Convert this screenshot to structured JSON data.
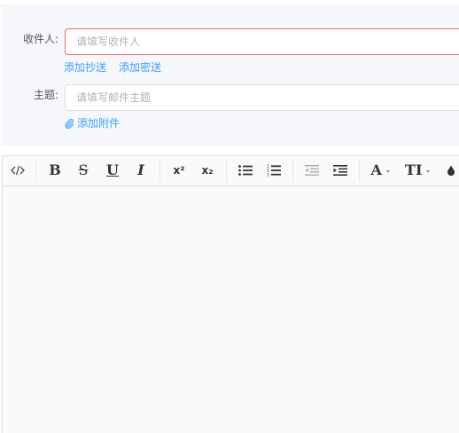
{
  "form": {
    "recipient_label": "收件人:",
    "recipient_placeholder": "请填写收件人",
    "add_cc": "添加抄送",
    "add_bcc": "添加密送",
    "subject_label": "主题:",
    "subject_placeholder": "请填写邮件主题",
    "add_attachment": "添加附件"
  },
  "toolbar": {
    "bold": "B",
    "strikethrough": "S",
    "underline": "U",
    "italic": "I",
    "superscript": "x²",
    "subscript": "x₂",
    "font": "A",
    "font_size": "TI"
  },
  "icons": {
    "code": "code-icon",
    "bullet_list": "bullet-list-icon",
    "numbered_list": "numbered-list-icon",
    "outdent": "outdent-icon",
    "indent": "indent-icon",
    "color": "color-drop-icon",
    "attachment": "paperclip-icon"
  },
  "colors": {
    "accent": "#409eff",
    "error_border": "#f56c6c"
  }
}
